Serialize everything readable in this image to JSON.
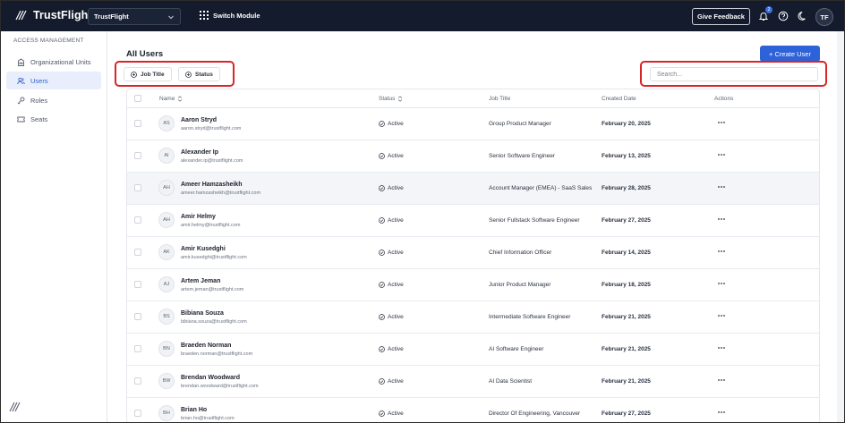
{
  "header": {
    "brand": "TrustFlight",
    "org_select": "TrustFlight",
    "switch_module": "Switch Module",
    "give_feedback": "Give Feedback",
    "notification_count": "2",
    "avatar_initials": "TF"
  },
  "sidebar": {
    "heading": "ACCESS MANAGEMENT",
    "items": [
      {
        "label": "Organizational Units",
        "icon": "building-icon",
        "active": false
      },
      {
        "label": "Users",
        "icon": "users-icon",
        "active": true
      },
      {
        "label": "Roles",
        "icon": "key-icon",
        "active": false
      },
      {
        "label": "Seats",
        "icon": "ticket-icon",
        "active": false
      }
    ]
  },
  "main": {
    "title": "All Users",
    "create_user": "+ Create User",
    "filters": [
      {
        "label": "Job Title",
        "icon": "plus-circle-icon"
      },
      {
        "label": "Status",
        "icon": "plus-circle-icon"
      }
    ],
    "search": {
      "placeholder": "Search...",
      "value": ""
    },
    "table": {
      "columns": [
        "Name",
        "Status",
        "Job Title",
        "Created Date",
        "Actions"
      ],
      "rows": [
        {
          "initials": "AS",
          "name": "Aaron Stryd",
          "email": "aaron.stryd@trustflight.com",
          "status": "Active",
          "job_title": "Group Product Manager",
          "created": "February 20, 2025"
        },
        {
          "initials": "AI",
          "name": "Alexander Ip",
          "email": "alexander.ip@trustflight.com",
          "status": "Active",
          "job_title": "Senior Software Engineer",
          "created": "February 13, 2025"
        },
        {
          "initials": "AH",
          "name": "Ameer Hamzasheikh",
          "email": "ameer.hamzasheikh@trustflight.com",
          "status": "Active",
          "job_title": "Account Manager (EMEA) - SaaS Sales",
          "created": "February 28, 2025"
        },
        {
          "initials": "AH",
          "name": "Amir Helmy",
          "email": "amir.helmy@trustflight.com",
          "status": "Active",
          "job_title": "Senior Fullstack Software Engineer",
          "created": "February 27, 2025"
        },
        {
          "initials": "AK",
          "name": "Amir Kusedghi",
          "email": "amir.kusedghi@trustflight.com",
          "status": "Active",
          "job_title": "Chief Information Officer",
          "created": "February 14, 2025"
        },
        {
          "initials": "AJ",
          "name": "Artem Jeman",
          "email": "artem.jeman@trustflight.com",
          "status": "Active",
          "job_title": "Junior Product Manager",
          "created": "February 18, 2025"
        },
        {
          "initials": "BS",
          "name": "Bibiana Souza",
          "email": "bibiana.souza@trustflight.com",
          "status": "Active",
          "job_title": "Intermediate Software Engineer",
          "created": "February 21, 2025"
        },
        {
          "initials": "BN",
          "name": "Braeden Norman",
          "email": "braeden.norman@trustflight.com",
          "status": "Active",
          "job_title": "AI Software Engineer",
          "created": "February 21, 2025"
        },
        {
          "initials": "BW",
          "name": "Brendan Woodward",
          "email": "brendan.woodward@trustflight.com",
          "status": "Active",
          "job_title": "AI Data Scientist",
          "created": "February 21, 2025"
        },
        {
          "initials": "BH",
          "name": "Brian Ho",
          "email": "brian.ho@trustflight.com",
          "status": "Active",
          "job_title": "Director Of Engineering, Vancouver",
          "created": "February 27, 2025"
        }
      ]
    }
  },
  "colors": {
    "topbar": "#141b2d",
    "accent": "#2e62d8",
    "highlight_box": "#d9252a",
    "active_nav_bg": "#e8eefb"
  }
}
